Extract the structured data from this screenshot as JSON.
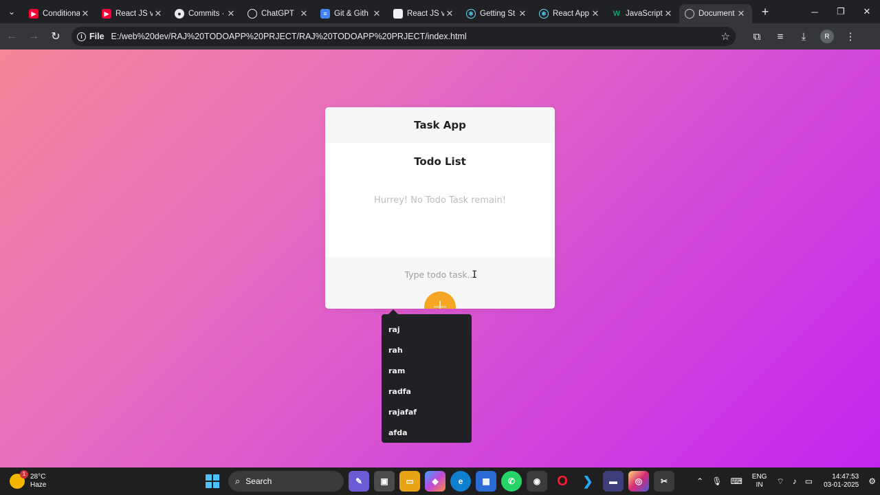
{
  "browser": {
    "tabs": [
      {
        "title": "Conditional",
        "icon": "youtube-icon"
      },
      {
        "title": "React JS v",
        "icon": "youtube-icon"
      },
      {
        "title": "Commits ·",
        "icon": "github-icon"
      },
      {
        "title": "ChatGPT",
        "icon": "chatgpt-icon"
      },
      {
        "title": "Git & Gith",
        "icon": "docs-icon"
      },
      {
        "title": "React JS v",
        "icon": "page-icon"
      },
      {
        "title": "Getting St",
        "icon": "react-icon"
      },
      {
        "title": "React App",
        "icon": "react-icon"
      },
      {
        "title": "JavaScript",
        "icon": "w3schools-icon"
      },
      {
        "title": "Document",
        "icon": "globe-icon",
        "active": true
      }
    ],
    "address_chip": "File",
    "url": "E:/web%20dev/RAJ%20TODOAPP%20PRJECT/RAJ%20TODOAPP%20PRJECT/index.html",
    "profile_initial": "R"
  },
  "app": {
    "header_title": "Task App",
    "list_title": "Todo List",
    "empty_message": "Hurrey! No Todo Task remain!",
    "input_placeholder": "Type todo task...",
    "add_button_label": "+",
    "autocomplete": [
      "raj",
      "rah",
      "ram",
      "radfa",
      "rajafaf",
      "afda"
    ]
  },
  "taskbar": {
    "weather_temp": "28°C",
    "weather_desc": "Haze",
    "weather_badge": "1",
    "search_label": "Search",
    "lang_top": "ENG",
    "lang_bottom": "IN",
    "time": "14:47:53",
    "date": "03-01-2025"
  },
  "colors": {
    "gradient_start": "#f5879a",
    "gradient_end": "#c226ee",
    "accent_button": "#f5a623"
  }
}
